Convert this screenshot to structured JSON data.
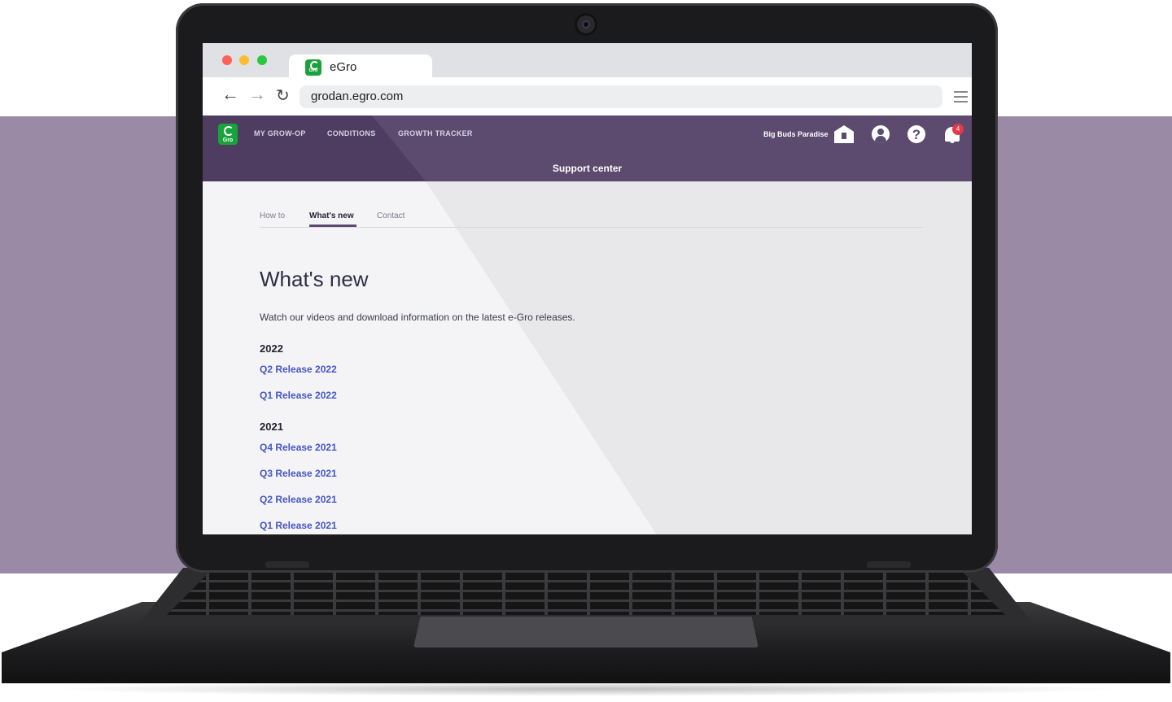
{
  "browser": {
    "tab_title": "eGro",
    "url": "grodan.egro.com",
    "tab_logo_text": "Gro"
  },
  "app": {
    "logo_text": "Gro",
    "nav": [
      "MY GROW-OP",
      "CONDITIONS",
      "GROWTH TRACKER"
    ],
    "farm_name": "Big Buds Paradise",
    "notification_count": "4",
    "header_title": "Support center",
    "help_glyph": "?"
  },
  "tabs": [
    {
      "label": "How to",
      "active": false
    },
    {
      "label": "What's new",
      "active": true
    },
    {
      "label": "Contact",
      "active": false
    }
  ],
  "content": {
    "title": "What's new",
    "intro": "Watch our videos and download information on the latest e-Gro releases.",
    "groups": [
      {
        "year": "2022",
        "releases": [
          "Q2 Release 2022",
          "Q1 Release 2022"
        ]
      },
      {
        "year": "2021",
        "releases": [
          "Q4 Release 2021",
          "Q3 Release 2021",
          "Q2 Release 2021",
          "Q1 Release 2021"
        ]
      }
    ]
  },
  "colors": {
    "background_band": "#9a8aa5",
    "header": "#5c4a6f",
    "link": "#4756c4",
    "badge": "#e5384a",
    "logo": "#1aa33d"
  }
}
